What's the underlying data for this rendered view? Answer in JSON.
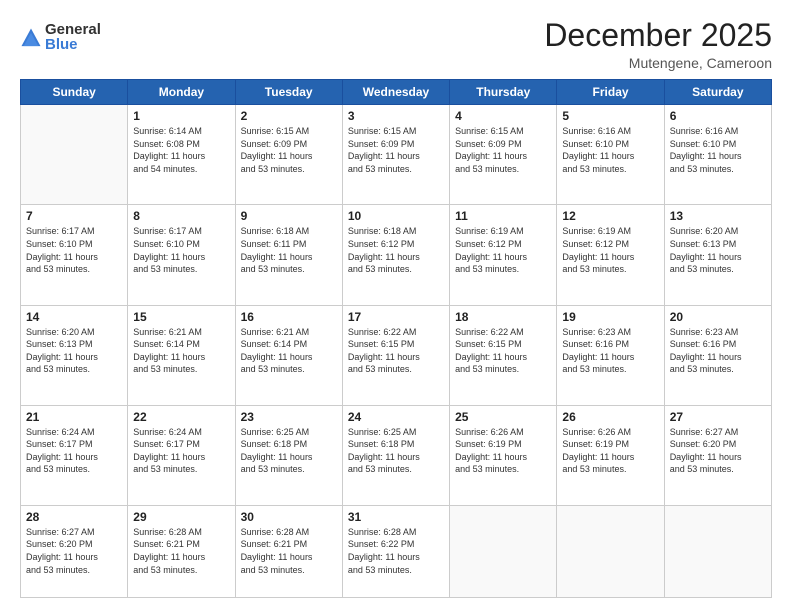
{
  "logo": {
    "general": "General",
    "blue": "Blue"
  },
  "title": "December 2025",
  "location": "Mutengene, Cameroon",
  "days_of_week": [
    "Sunday",
    "Monday",
    "Tuesday",
    "Wednesday",
    "Thursday",
    "Friday",
    "Saturday"
  ],
  "weeks": [
    [
      {
        "day": "",
        "info": ""
      },
      {
        "day": "1",
        "info": "Sunrise: 6:14 AM\nSunset: 6:08 PM\nDaylight: 11 hours\nand 54 minutes."
      },
      {
        "day": "2",
        "info": "Sunrise: 6:15 AM\nSunset: 6:09 PM\nDaylight: 11 hours\nand 53 minutes."
      },
      {
        "day": "3",
        "info": "Sunrise: 6:15 AM\nSunset: 6:09 PM\nDaylight: 11 hours\nand 53 minutes."
      },
      {
        "day": "4",
        "info": "Sunrise: 6:15 AM\nSunset: 6:09 PM\nDaylight: 11 hours\nand 53 minutes."
      },
      {
        "day": "5",
        "info": "Sunrise: 6:16 AM\nSunset: 6:10 PM\nDaylight: 11 hours\nand 53 minutes."
      },
      {
        "day": "6",
        "info": "Sunrise: 6:16 AM\nSunset: 6:10 PM\nDaylight: 11 hours\nand 53 minutes."
      }
    ],
    [
      {
        "day": "7",
        "info": ""
      },
      {
        "day": "8",
        "info": "Sunrise: 6:17 AM\nSunset: 6:10 PM\nDaylight: 11 hours\nand 53 minutes."
      },
      {
        "day": "9",
        "info": "Sunrise: 6:18 AM\nSunset: 6:11 PM\nDaylight: 11 hours\nand 53 minutes."
      },
      {
        "day": "10",
        "info": "Sunrise: 6:18 AM\nSunset: 6:12 PM\nDaylight: 11 hours\nand 53 minutes."
      },
      {
        "day": "11",
        "info": "Sunrise: 6:19 AM\nSunset: 6:12 PM\nDaylight: 11 hours\nand 53 minutes."
      },
      {
        "day": "12",
        "info": "Sunrise: 6:19 AM\nSunset: 6:12 PM\nDaylight: 11 hours\nand 53 minutes."
      },
      {
        "day": "13",
        "info": "Sunrise: 6:20 AM\nSunset: 6:13 PM\nDaylight: 11 hours\nand 53 minutes."
      }
    ],
    [
      {
        "day": "14",
        "info": ""
      },
      {
        "day": "15",
        "info": "Sunrise: 6:21 AM\nSunset: 6:14 PM\nDaylight: 11 hours\nand 53 minutes."
      },
      {
        "day": "16",
        "info": "Sunrise: 6:21 AM\nSunset: 6:14 PM\nDaylight: 11 hours\nand 53 minutes."
      },
      {
        "day": "17",
        "info": "Sunrise: 6:22 AM\nSunset: 6:15 PM\nDaylight: 11 hours\nand 53 minutes."
      },
      {
        "day": "18",
        "info": "Sunrise: 6:22 AM\nSunset: 6:15 PM\nDaylight: 11 hours\nand 53 minutes."
      },
      {
        "day": "19",
        "info": "Sunrise: 6:23 AM\nSunset: 6:16 PM\nDaylight: 11 hours\nand 53 minutes."
      },
      {
        "day": "20",
        "info": "Sunrise: 6:23 AM\nSunset: 6:16 PM\nDaylight: 11 hours\nand 53 minutes."
      }
    ],
    [
      {
        "day": "21",
        "info": ""
      },
      {
        "day": "22",
        "info": "Sunrise: 6:24 AM\nSunset: 6:17 PM\nDaylight: 11 hours\nand 53 minutes."
      },
      {
        "day": "23",
        "info": "Sunrise: 6:25 AM\nSunset: 6:18 PM\nDaylight: 11 hours\nand 53 minutes."
      },
      {
        "day": "24",
        "info": "Sunrise: 6:25 AM\nSunset: 6:18 PM\nDaylight: 11 hours\nand 53 minutes."
      },
      {
        "day": "25",
        "info": "Sunrise: 6:26 AM\nSunset: 6:19 PM\nDaylight: 11 hours\nand 53 minutes."
      },
      {
        "day": "26",
        "info": "Sunrise: 6:26 AM\nSunset: 6:19 PM\nDaylight: 11 hours\nand 53 minutes."
      },
      {
        "day": "27",
        "info": "Sunrise: 6:27 AM\nSunset: 6:20 PM\nDaylight: 11 hours\nand 53 minutes."
      }
    ],
    [
      {
        "day": "28",
        "info": "Sunrise: 6:27 AM\nSunset: 6:20 PM\nDaylight: 11 hours\nand 53 minutes."
      },
      {
        "day": "29",
        "info": "Sunrise: 6:28 AM\nSunset: 6:21 PM\nDaylight: 11 hours\nand 53 minutes."
      },
      {
        "day": "30",
        "info": "Sunrise: 6:28 AM\nSunset: 6:21 PM\nDaylight: 11 hours\nand 53 minutes."
      },
      {
        "day": "31",
        "info": "Sunrise: 6:28 AM\nSunset: 6:22 PM\nDaylight: 11 hours\nand 53 minutes."
      },
      {
        "day": "",
        "info": ""
      },
      {
        "day": "",
        "info": ""
      },
      {
        "day": "",
        "info": ""
      }
    ]
  ],
  "week7_sunday_info": "Sunrise: 6:17 AM\nSunset: 6:10 PM\nDaylight: 11 hours\nand 53 minutes.",
  "week14_sunday_info": "Sunrise: 6:20 AM\nSunset: 6:13 PM\nDaylight: 11 hours\nand 53 minutes.",
  "week21_sunday_info": "Sunrise: 6:24 AM\nSunset: 6:17 PM\nDaylight: 11 hours\nand 53 minutes."
}
